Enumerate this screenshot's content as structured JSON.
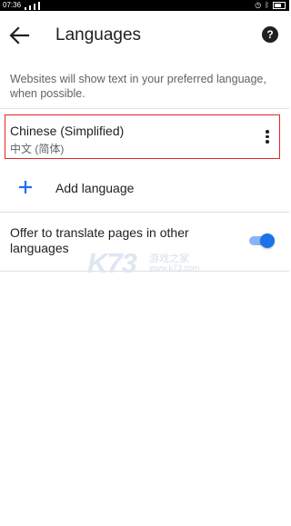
{
  "status_bar": {
    "time": "07:36",
    "icons": [
      "signal-icon",
      "wifi-icon",
      "alarm-icon",
      "bluetooth-icon",
      "battery-icon"
    ]
  },
  "app_bar": {
    "title": "Languages",
    "back_icon": "arrow-back-icon",
    "help_icon": "help-icon",
    "help_glyph": "?"
  },
  "description": "Websites will show text in your preferred language, when possible.",
  "languages": [
    {
      "name": "Chinese (Simplified)",
      "native": "中文 (简体)",
      "menu_icon": "more-vert-icon"
    }
  ],
  "add_language": {
    "label": "Add language",
    "icon": "plus-icon"
  },
  "translate_offer": {
    "label": "Offer to translate pages in other languages",
    "enabled": true
  },
  "watermark": {
    "logo": "K73",
    "text": "游戏之家",
    "url": "www.k73.com"
  },
  "colors": {
    "accent": "#1a73e8",
    "highlight_border": "#e0262a",
    "toggle_track": "#8ab4f8"
  }
}
